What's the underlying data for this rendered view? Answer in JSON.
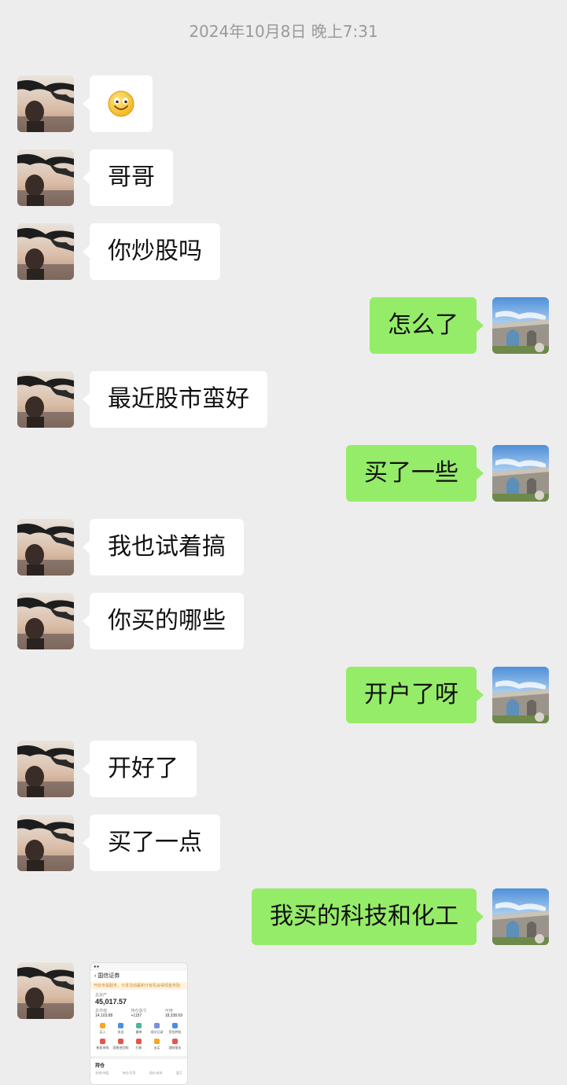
{
  "timestamp": "2024年10月8日 晚上7:31",
  "emoji": "smiley-face",
  "messages": [
    {
      "side": "in",
      "text": "哥哥"
    },
    {
      "side": "in",
      "text": "你炒股吗"
    },
    {
      "side": "out",
      "text": "怎么了"
    },
    {
      "side": "in",
      "text": "最近股市蛮好"
    },
    {
      "side": "out",
      "text": "买了一些"
    },
    {
      "side": "in",
      "text": "我也试着搞"
    },
    {
      "side": "in",
      "text": "你买的哪些"
    },
    {
      "side": "out",
      "text": "开户了呀"
    },
    {
      "side": "in",
      "text": "开好了"
    },
    {
      "side": "in",
      "text": "买了一点"
    },
    {
      "side": "out",
      "text": "我买的科技和化工"
    }
  ],
  "screenshot_message": {
    "app_title": "国信证券",
    "notice": "开启专属服务，分享活动赢积分有机会得现金奖励",
    "total_assets_label": "总资产",
    "total_assets": "45,017.57",
    "today_pl_label": "今日盈亏",
    "today_pl": "+1157",
    "total_market_label": "总市值",
    "total_market": "14,103.88",
    "position_pl_label": "持仓盈亏",
    "position_pl": "+1157",
    "available_label": "可用",
    "available": "18,338.69",
    "actions": [
      "买入",
      "卖出",
      "撤单",
      "成交记录",
      "资金转账",
      "新股申购",
      "国债逆回购",
      "打新",
      "去买",
      "理财基金"
    ],
    "holdings_label": "持仓",
    "holdings_cols": [
      "名称/市值",
      "持仓/可用",
      "现价/成本",
      "盈亏"
    ]
  },
  "colors": {
    "background": "#ededed",
    "incoming_bubble": "#ffffff",
    "outgoing_bubble": "#95ec69"
  }
}
